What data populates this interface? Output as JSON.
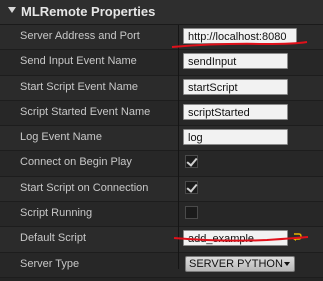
{
  "panel": {
    "title": "MLRemote Properties"
  },
  "rows": [
    {
      "label": "Server Address and Port",
      "type": "text",
      "value": "http://localhost:8080"
    },
    {
      "label": "Send Input Event Name",
      "type": "text",
      "value": "sendInput"
    },
    {
      "label": "Start Script Event Name",
      "type": "text",
      "value": "startScript"
    },
    {
      "label": "Script Started Event Name",
      "type": "text",
      "value": "scriptStarted"
    },
    {
      "label": "Log Event Name",
      "type": "text",
      "value": "log"
    },
    {
      "label": "Connect on Begin Play",
      "type": "checkbox",
      "checked": true
    },
    {
      "label": "Start Script on Connection",
      "type": "checkbox",
      "checked": true
    },
    {
      "label": "Script Running",
      "type": "checkbox",
      "checked": false
    },
    {
      "label": "Default Script",
      "type": "text",
      "value": "add_example"
    },
    {
      "label": "Server Type",
      "type": "dropdown",
      "value": "SERVER PYTHON"
    }
  ],
  "icons": {
    "collapse": "collapse-arrow-icon",
    "reset": "reset-to-default-icon"
  },
  "colors": {
    "annotation": "#e0101a",
    "reset_icon": "#e8b400"
  }
}
